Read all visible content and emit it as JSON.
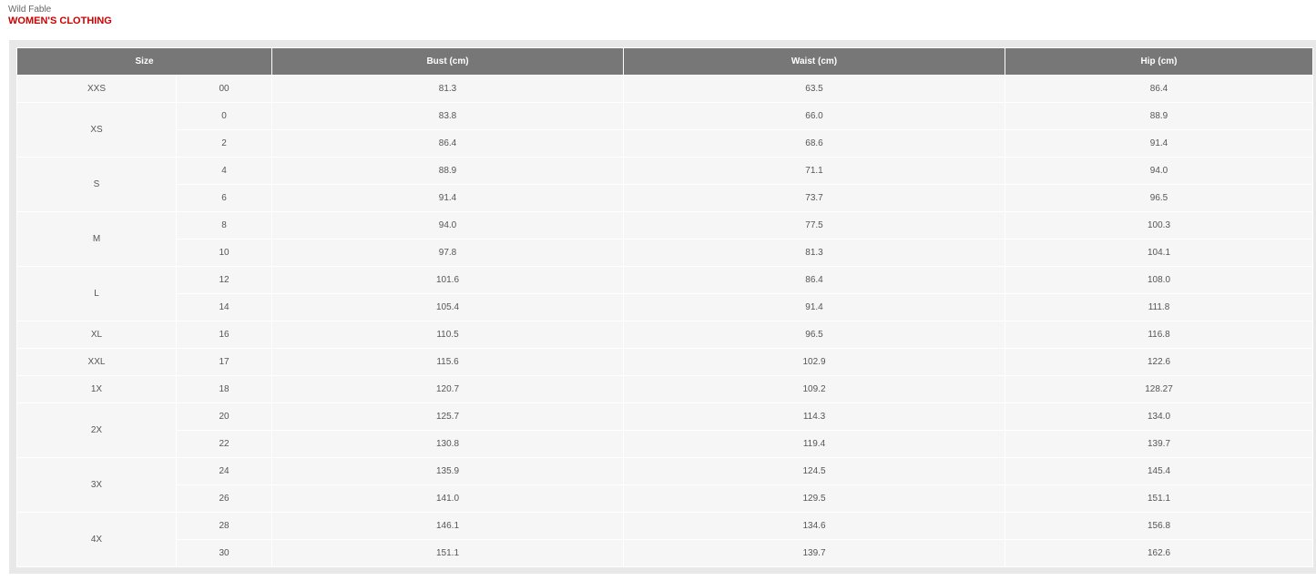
{
  "header": {
    "brand": "Wild Fable",
    "category": "WOMEN'S CLOTHING"
  },
  "table": {
    "columns": [
      "Size",
      "Bust (cm)",
      "Waist (cm)",
      "Hip (cm)"
    ],
    "groups": [
      {
        "size": "XXS",
        "rows": [
          {
            "num": "00",
            "bust": "81.3",
            "waist": "63.5",
            "hip": "86.4"
          }
        ]
      },
      {
        "size": "XS",
        "rows": [
          {
            "num": "0",
            "bust": "83.8",
            "waist": "66.0",
            "hip": "88.9"
          },
          {
            "num": "2",
            "bust": "86.4",
            "waist": "68.6",
            "hip": "91.4"
          }
        ]
      },
      {
        "size": "S",
        "rows": [
          {
            "num": "4",
            "bust": "88.9",
            "waist": "71.1",
            "hip": "94.0"
          },
          {
            "num": "6",
            "bust": "91.4",
            "waist": "73.7",
            "hip": "96.5"
          }
        ]
      },
      {
        "size": "M",
        "rows": [
          {
            "num": "8",
            "bust": "94.0",
            "waist": "77.5",
            "hip": "100.3"
          },
          {
            "num": "10",
            "bust": "97.8",
            "waist": "81.3",
            "hip": "104.1"
          }
        ]
      },
      {
        "size": "L",
        "rows": [
          {
            "num": "12",
            "bust": "101.6",
            "waist": "86.4",
            "hip": "108.0"
          },
          {
            "num": "14",
            "bust": "105.4",
            "waist": "91.4",
            "hip": "111.8"
          }
        ]
      },
      {
        "size": "XL",
        "rows": [
          {
            "num": "16",
            "bust": "110.5",
            "waist": "96.5",
            "hip": "116.8"
          }
        ]
      },
      {
        "size": "XXL",
        "rows": [
          {
            "num": "17",
            "bust": "115.6",
            "waist": "102.9",
            "hip": "122.6"
          }
        ]
      },
      {
        "size": "1X",
        "rows": [
          {
            "num": "18",
            "bust": "120.7",
            "waist": "109.2",
            "hip": "128.27"
          }
        ]
      },
      {
        "size": "2X",
        "rows": [
          {
            "num": "20",
            "bust": "125.7",
            "waist": "114.3",
            "hip": "134.0"
          },
          {
            "num": "22",
            "bust": "130.8",
            "waist": "119.4",
            "hip": "139.7"
          }
        ]
      },
      {
        "size": "3X",
        "rows": [
          {
            "num": "24",
            "bust": "135.9",
            "waist": "124.5",
            "hip": "145.4"
          },
          {
            "num": "26",
            "bust": "141.0",
            "waist": "129.5",
            "hip": "151.1"
          }
        ]
      },
      {
        "size": "4X",
        "rows": [
          {
            "num": "28",
            "bust": "146.1",
            "waist": "134.6",
            "hip": "156.8"
          },
          {
            "num": "30",
            "bust": "151.1",
            "waist": "139.7",
            "hip": "162.6"
          }
        ]
      }
    ]
  },
  "colors": {
    "header_bg": "#777777",
    "cell_bg": "#f6f6f6",
    "frame_bg": "#e8e8e8",
    "category_red": "#cc0000"
  }
}
